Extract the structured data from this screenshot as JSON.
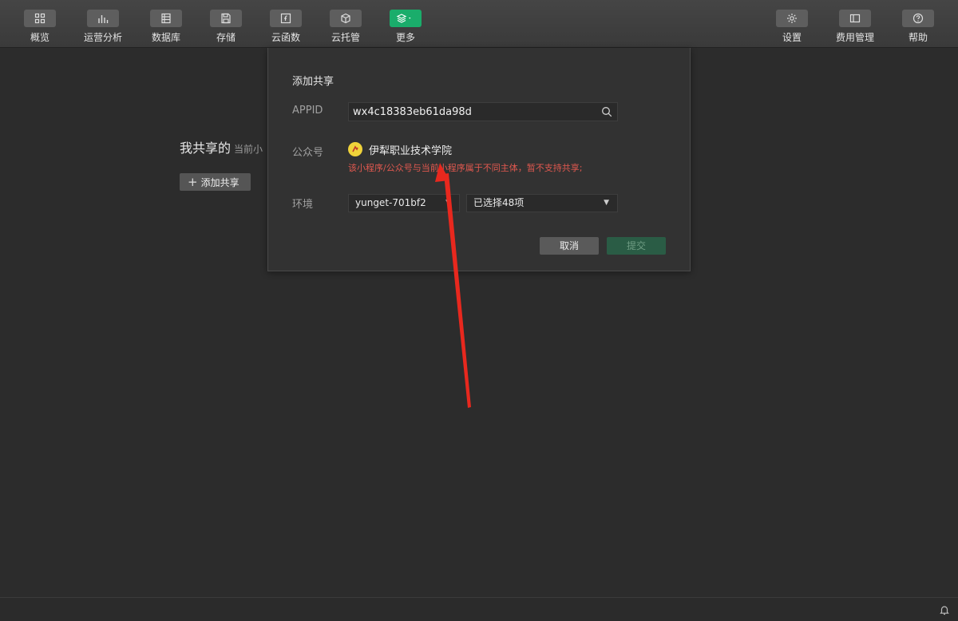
{
  "toolbar": {
    "left": [
      {
        "label": "概览",
        "icon": "grid-icon"
      },
      {
        "label": "运营分析",
        "icon": "bar-chart-icon"
      },
      {
        "label": "数据库",
        "icon": "database-icon"
      },
      {
        "label": "存储",
        "icon": "save-icon"
      },
      {
        "label": "云函数",
        "icon": "function-icon"
      },
      {
        "label": "云托管",
        "icon": "cube-icon"
      },
      {
        "label": "更多",
        "icon": "layers-icon"
      }
    ],
    "right": [
      {
        "label": "设置",
        "icon": "gear-icon"
      },
      {
        "label": "费用管理",
        "icon": "billing-icon"
      },
      {
        "label": "帮助",
        "icon": "help-icon"
      }
    ]
  },
  "page": {
    "title": "我共享的",
    "subtitle": "当前小",
    "add_share_label": "添加共享"
  },
  "dialog": {
    "title": "添加共享",
    "appid_label": "APPID",
    "appid_value": "wx4c18383eb61da98d",
    "account_label": "公众号",
    "account_name": "伊犁职业技术学院",
    "error_text": "该小程序/公众号与当前小程序属于不同主体，暂不支持共享;",
    "env_label": "环境",
    "env_value": "yunget-701bf2",
    "scope_value": "已选择48项",
    "cancel_label": "取消",
    "submit_label": "提交"
  },
  "colors": {
    "accent": "#1aad6b",
    "error": "#e0584f",
    "annotation_arrow": "#e8281e"
  }
}
